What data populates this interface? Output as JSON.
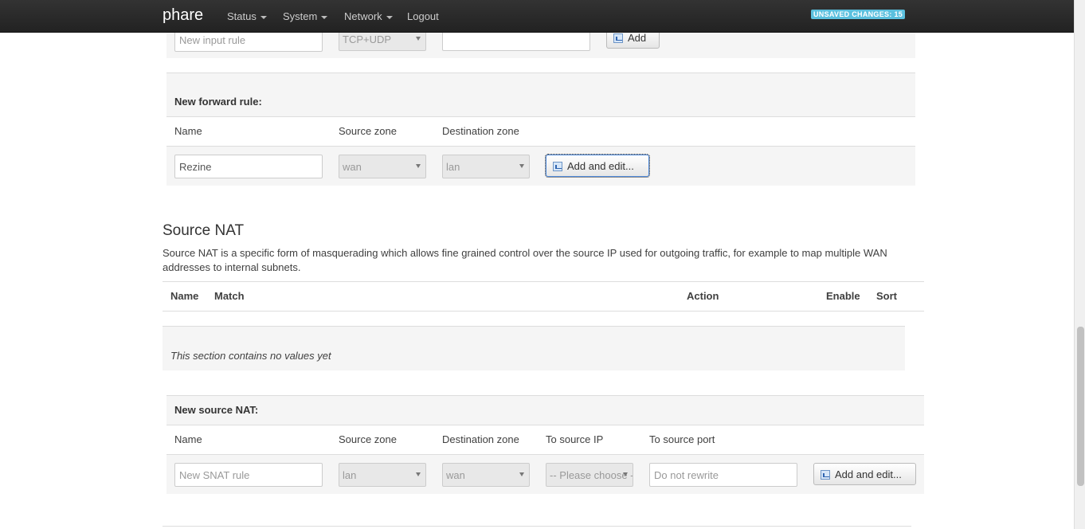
{
  "navbar": {
    "brand": "phare",
    "menu": [
      "Status",
      "System",
      "Network"
    ],
    "logout": "Logout",
    "unsaved": "UNSAVED CHANGES: 15"
  },
  "input_rule": {
    "name_placeholder": "New input rule",
    "protocol": "TCP+UDP",
    "add_label": "Add"
  },
  "forward_rule": {
    "title": "New forward rule:",
    "cols": [
      "Name",
      "Source zone",
      "Destination zone"
    ],
    "name_value": "Rezine",
    "source_zone": "wan",
    "dest_zone": "lan",
    "add_label": "Add and edit..."
  },
  "snat": {
    "heading": "Source NAT",
    "description": "Source NAT is a specific form of masquerading which allows fine grained control over the source IP used for outgoing traffic, for example to map multiple WAN addresses to internal subnets.",
    "table_cols": [
      "Name",
      "Match",
      "Action",
      "Enable",
      "Sort"
    ],
    "empty_text": "This section contains no values yet",
    "new_title": "New source NAT:",
    "new_cols": [
      "Name",
      "Source zone",
      "Destination zone",
      "To source IP",
      "To source port"
    ],
    "name_placeholder": "New SNAT rule",
    "source_zone": "lan",
    "dest_zone": "wan",
    "to_ip": "-- Please choose --",
    "to_port_placeholder": "Do not rewrite",
    "add_label": "Add and edit..."
  }
}
